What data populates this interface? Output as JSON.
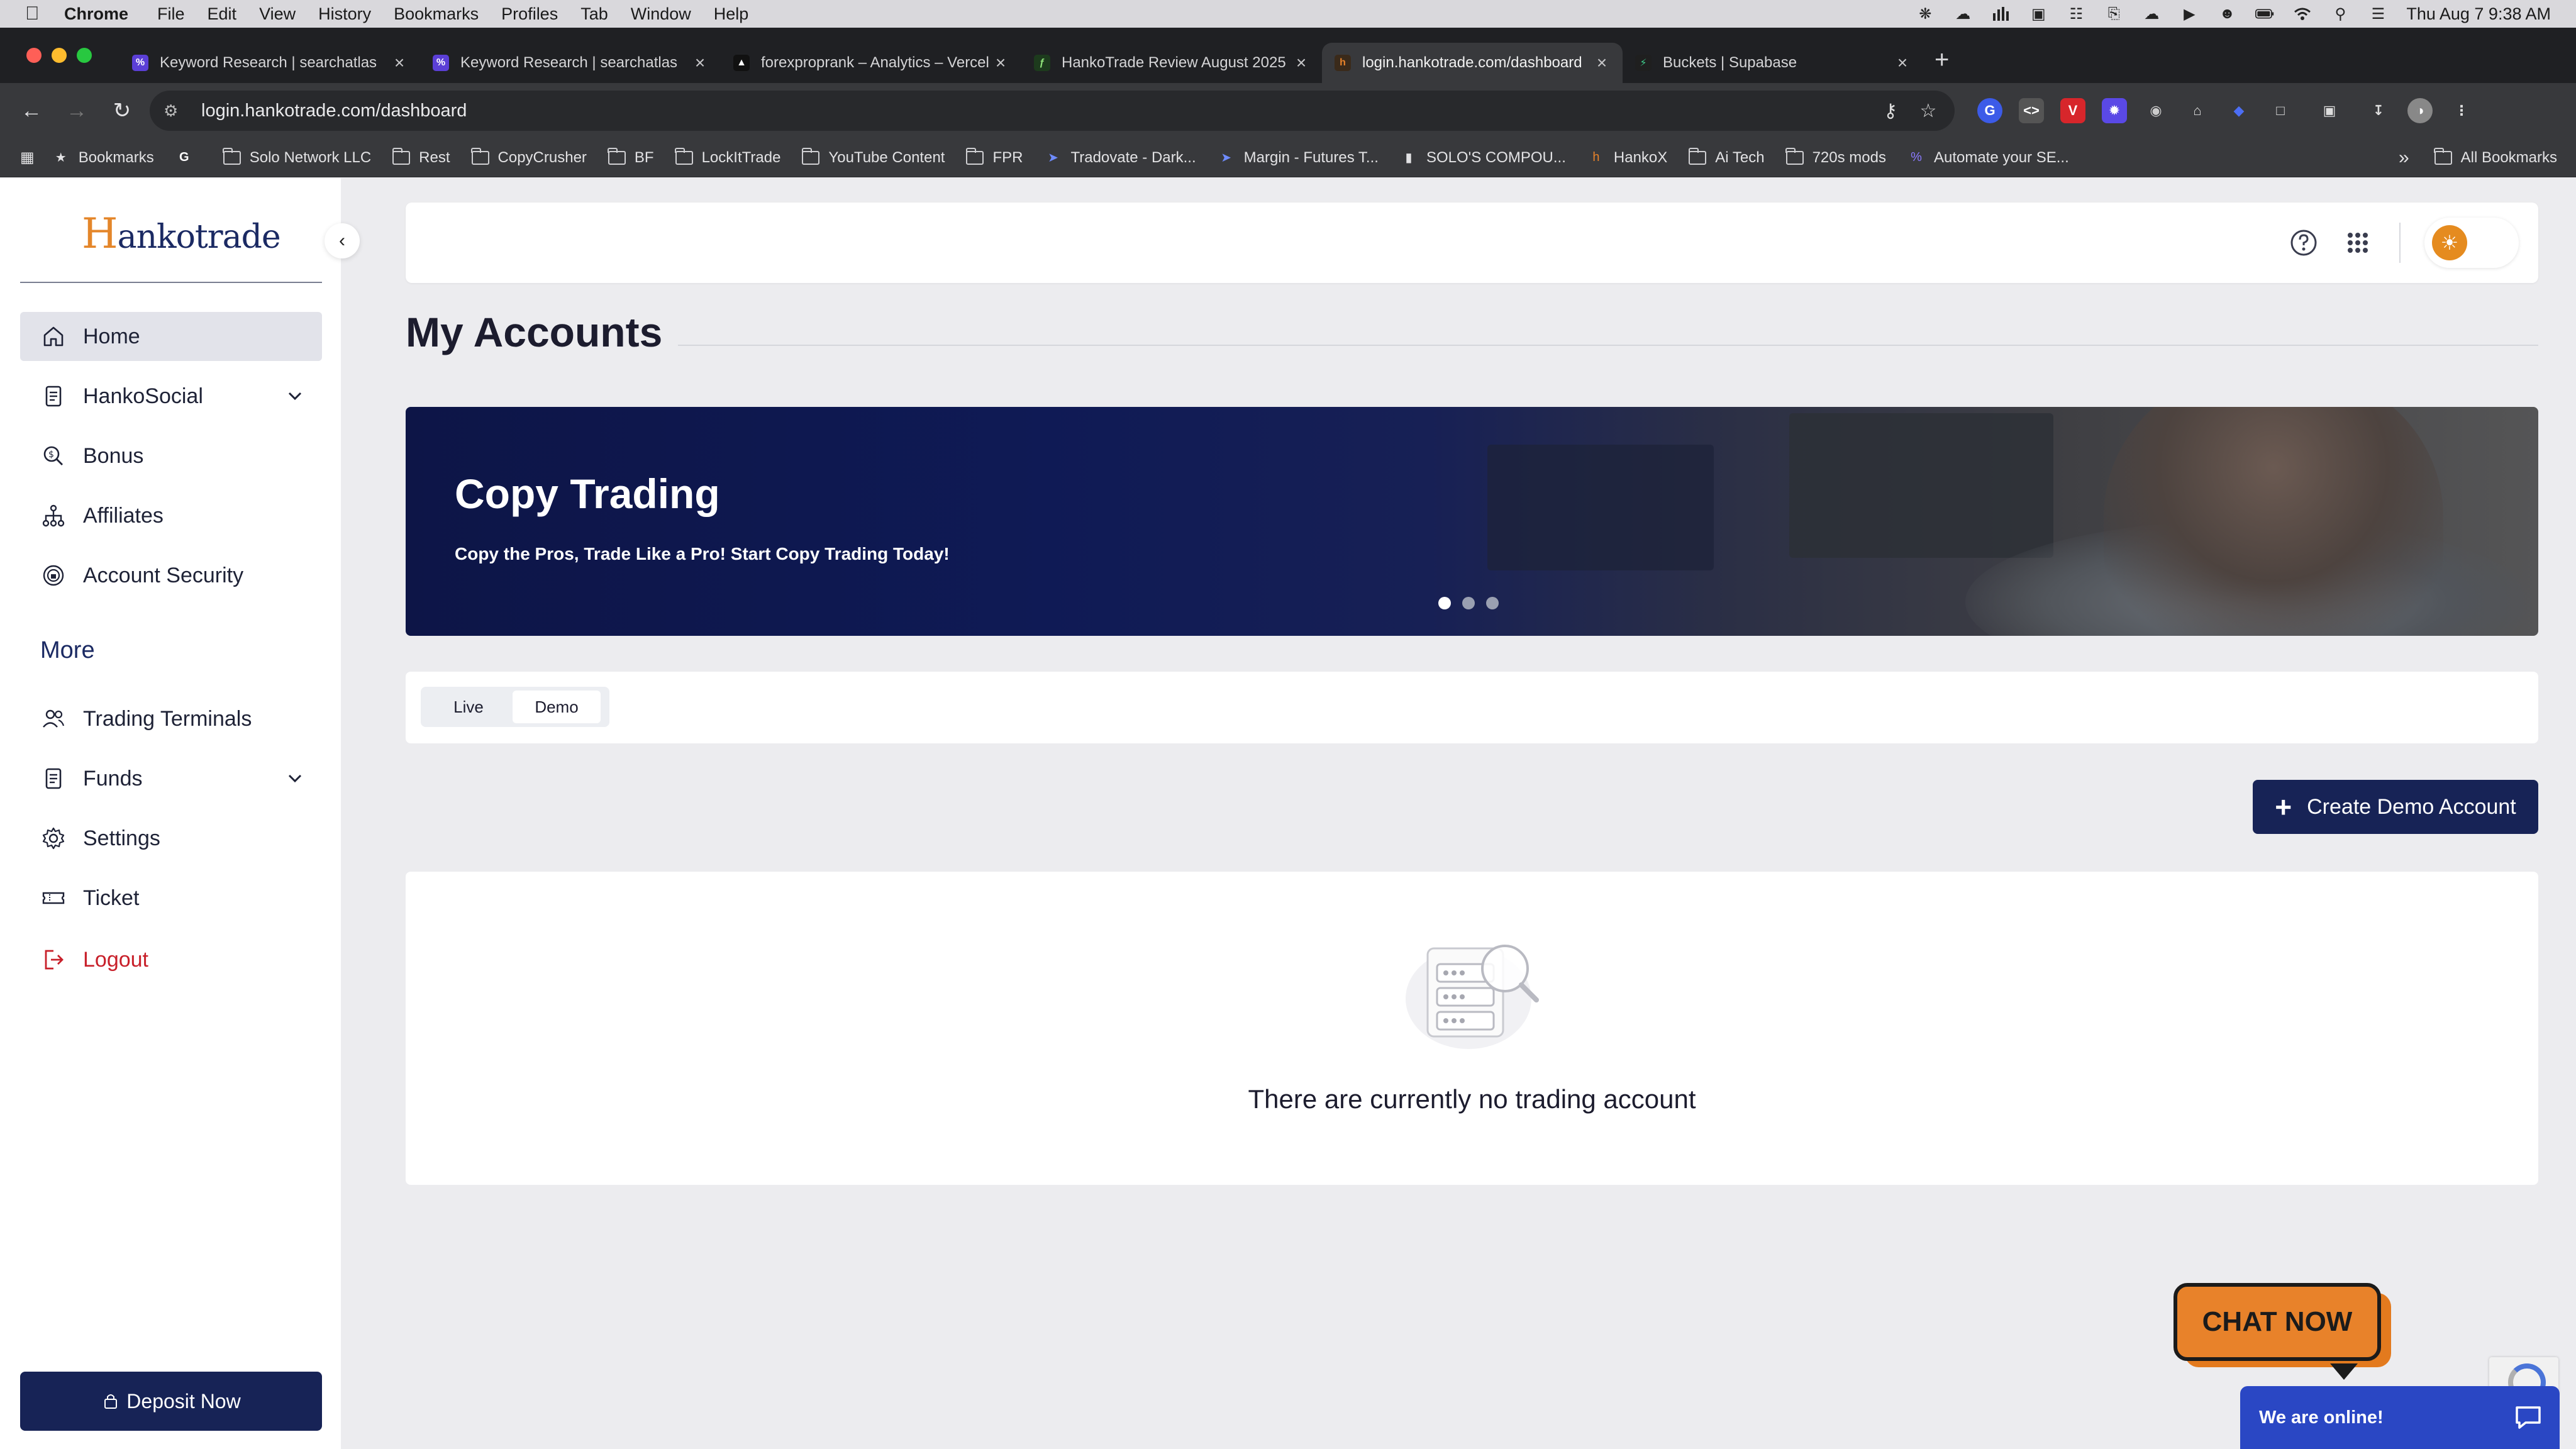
{
  "os_menubar": {
    "app_name": "Chrome",
    "menus": [
      "File",
      "Edit",
      "View",
      "History",
      "Bookmarks",
      "Profiles",
      "Tab",
      "Window",
      "Help"
    ],
    "datetime": "Thu Aug 7  9:38 AM"
  },
  "browser": {
    "tabs": [
      {
        "title": "Keyword Research | searchatlas",
        "favicon_color": "#5b3fd6",
        "favicon_glyph": "%"
      },
      {
        "title": "Keyword Research | searchatlas",
        "favicon_color": "#5b3fd6",
        "favicon_glyph": "%"
      },
      {
        "title": "forexproprank – Analytics – Vercel",
        "favicon_color": "#111111",
        "favicon_glyph": "▲"
      },
      {
        "title": "HankoTrade Review August 2025",
        "favicon_color": "#1d3b1d",
        "favicon_glyph": "ƒ"
      },
      {
        "title": "login.hankotrade.com/dashboard",
        "favicon_color": "#3a2a1a",
        "favicon_glyph": "h",
        "active": true
      },
      {
        "title": "Buckets | Supabase",
        "favicon_color": "#1f1f1f",
        "favicon_glyph": "⚡"
      }
    ],
    "url": "login.hankotrade.com/dashboard",
    "bookmarks": [
      {
        "label": "Bookmarks",
        "icon": "star-icon"
      },
      {
        "label": "",
        "icon": "google-icon"
      },
      {
        "label": "Solo Network LLC",
        "icon": "folder-icon"
      },
      {
        "label": "Rest",
        "icon": "folder-icon"
      },
      {
        "label": "CopyCrusher",
        "icon": "folder-icon"
      },
      {
        "label": "BF",
        "icon": "folder-icon"
      },
      {
        "label": "LockItTrade",
        "icon": "folder-icon"
      },
      {
        "label": "YouTube Content",
        "icon": "folder-icon"
      },
      {
        "label": "FPR",
        "icon": "folder-icon"
      },
      {
        "label": "Tradovate - Dark...",
        "icon": "tradovate-icon"
      },
      {
        "label": "Margin - Futures T...",
        "icon": "tradovate-icon"
      },
      {
        "label": "SOLO'S COMPOU...",
        "icon": "page-icon"
      },
      {
        "label": "HankoX",
        "icon": "hanko-icon"
      },
      {
        "label": "Ai Tech",
        "icon": "folder-icon"
      },
      {
        "label": "720s mods",
        "icon": "folder-icon"
      },
      {
        "label": "Automate your SE...",
        "icon": "searchatlas-icon"
      }
    ],
    "all_bookmarks": "All Bookmarks"
  },
  "sidebar": {
    "logo_first": "H",
    "logo_rest": "ankotrade",
    "items": [
      {
        "label": "Home",
        "icon": "home-icon",
        "active": true
      },
      {
        "label": "HankoSocial",
        "icon": "document-icon",
        "expandable": true
      },
      {
        "label": "Bonus",
        "icon": "bonus-icon"
      },
      {
        "label": "Affiliates",
        "icon": "network-icon"
      },
      {
        "label": "Account Security",
        "icon": "shield-icon"
      }
    ],
    "more_heading": "More",
    "more_items": [
      {
        "label": "Trading Terminals",
        "icon": "users-icon"
      },
      {
        "label": "Funds",
        "icon": "document-icon",
        "expandable": true
      },
      {
        "label": "Settings",
        "icon": "gear-icon"
      },
      {
        "label": "Ticket",
        "icon": "ticket-icon"
      },
      {
        "label": "Logout",
        "icon": "logout-icon",
        "danger": true
      }
    ],
    "deposit_label": "Deposit Now"
  },
  "main": {
    "title": "My Accounts",
    "banner": {
      "title": "Copy Trading",
      "subtitle": "Copy the Pros, Trade Like a Pro! Start Copy Trading Today!",
      "slides": 3,
      "active_slide": 1
    },
    "tabs": [
      {
        "label": "Live"
      },
      {
        "label": "Demo",
        "active": true
      }
    ],
    "create_button": "Create Demo Account",
    "empty_message": "There are currently no trading account"
  },
  "chat": {
    "cta": "CHAT NOW",
    "status": "We are online!"
  },
  "colors": {
    "brand_navy": "#172356",
    "brand_orange": "#e8822a",
    "danger": "#c8202a",
    "chat_blue": "#2a47c4"
  }
}
